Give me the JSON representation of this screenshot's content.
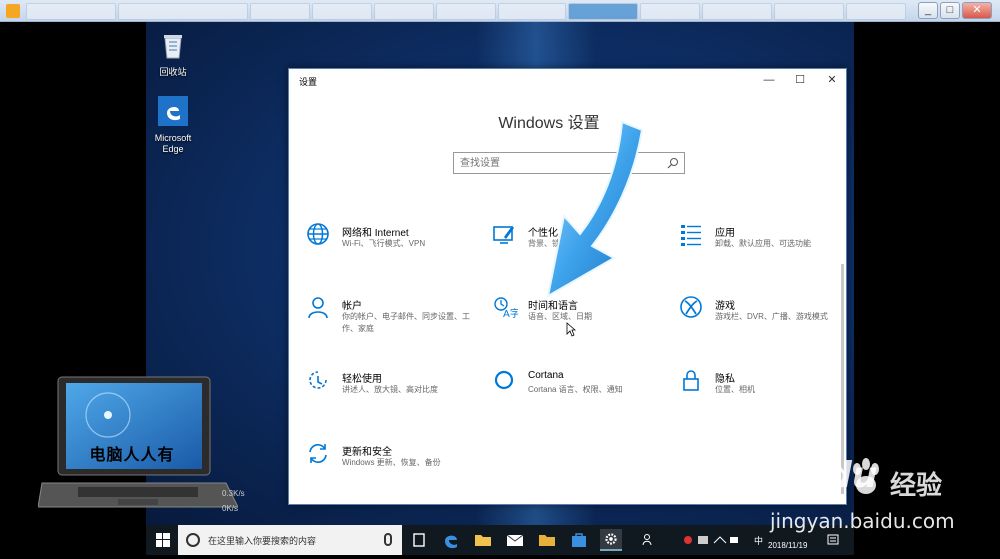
{
  "desktop": {
    "icons": [
      {
        "label": "回收站"
      },
      {
        "label": "Microsoft Edge"
      }
    ]
  },
  "settings": {
    "window_title": "设置",
    "heading": "Windows 设置",
    "search_placeholder": "查找设置",
    "tiles": [
      {
        "title": "网络和 Internet",
        "desc": "Wi-Fi、飞行模式、VPN",
        "icon": "globe-icon"
      },
      {
        "title": "个性化",
        "desc": "背景、锁屏、颜色",
        "icon": "personalization-icon"
      },
      {
        "title": "应用",
        "desc": "卸载、默认应用、可选功能",
        "icon": "apps-icon"
      },
      {
        "title": "帐户",
        "desc": "你的帐户、电子邮件、同步设置、工作、家庭",
        "icon": "person-icon"
      },
      {
        "title": "时间和语言",
        "desc": "语音、区域、日期",
        "icon": "time-language-icon"
      },
      {
        "title": "游戏",
        "desc": "游戏栏、DVR、广播、游戏模式",
        "icon": "xbox-icon"
      },
      {
        "title": "轻松使用",
        "desc": "讲述人、放大镜、高对比度",
        "icon": "ease-of-access-icon"
      },
      {
        "title": "Cortana",
        "desc": "Cortana 语言、权限、通知",
        "icon": "cortana-icon"
      },
      {
        "title": "隐私",
        "desc": "位置、相机",
        "icon": "lock-icon"
      },
      {
        "title": "更新和安全",
        "desc": "Windows 更新、恢复、备份",
        "icon": "update-icon"
      }
    ]
  },
  "taskbar": {
    "search_placeholder": "在这里输入你要搜索的内容",
    "ime": "中",
    "date": "2018/11/19"
  },
  "overlay": {
    "logo_caption": "电脑人人有",
    "net_up": "0.3K/s",
    "net_down": "0K/s",
    "watermark_brand": "Baidu",
    "watermark_cn": "经验",
    "watermark_url": "jingyan.baidu.com"
  },
  "colors": {
    "accent": "#0078d7",
    "arrow": "#3fa4ec"
  }
}
